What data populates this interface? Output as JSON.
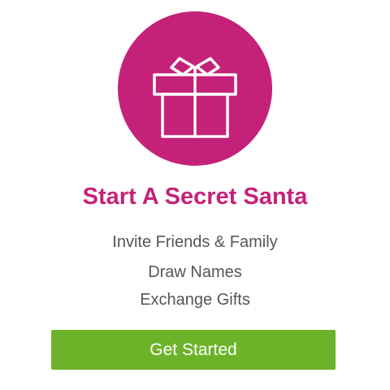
{
  "colors": {
    "accent": "#c42279",
    "button": "#6db32a",
    "body_text": "#555555"
  },
  "hero": {
    "icon": "gift-icon"
  },
  "title": "Start A Secret Santa",
  "steps": [
    "Invite Friends & Family",
    "Draw Names",
    "Exchange Gifts"
  ],
  "cta": {
    "label": "Get Started"
  }
}
